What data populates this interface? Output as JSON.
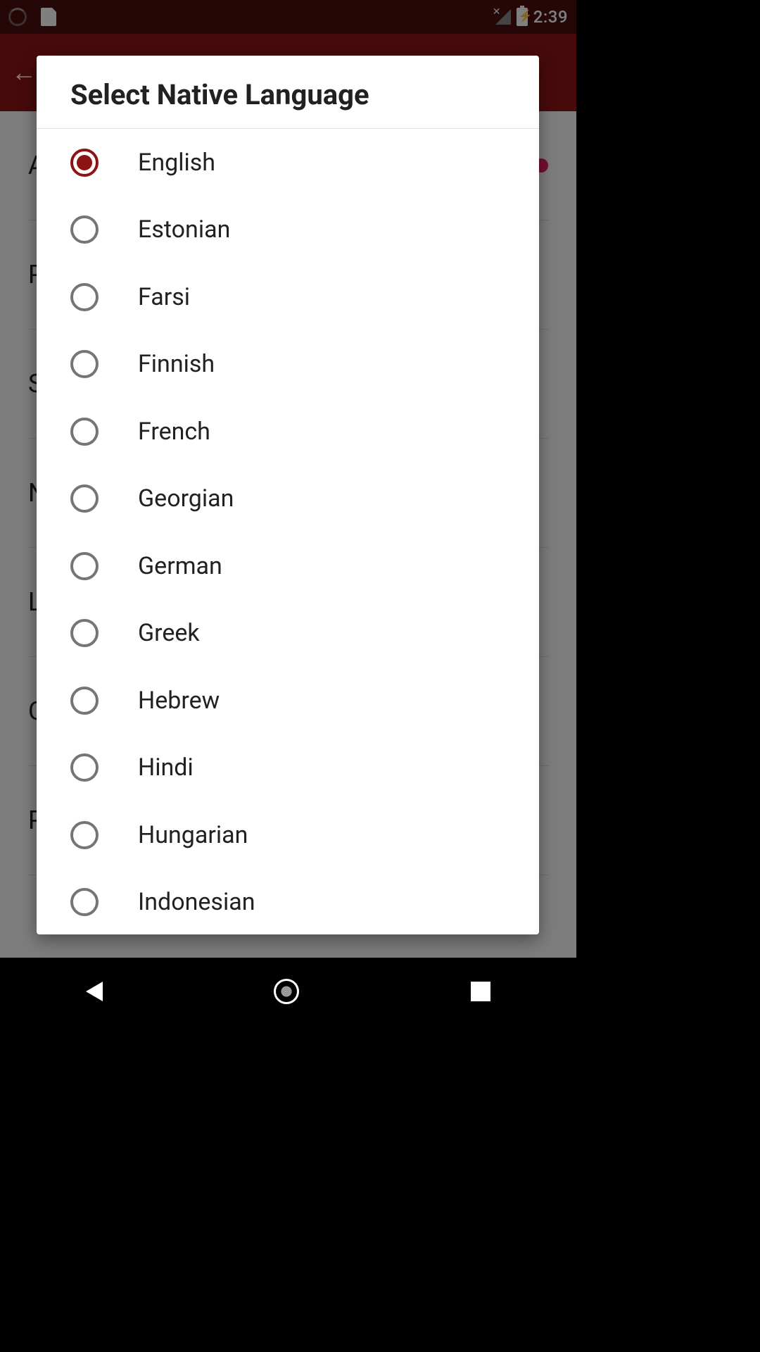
{
  "status_bar": {
    "time": "2:39"
  },
  "dialog": {
    "title": "Select Native Language",
    "selected_index": 0,
    "options": [
      "English",
      "Estonian",
      "Farsi",
      "Finnish",
      "French",
      "Georgian",
      "German",
      "Greek",
      "Hebrew",
      "Hindi",
      "Hungarian",
      "Indonesian"
    ]
  },
  "background": {
    "items": [
      "A",
      "P",
      "S",
      "N",
      "L",
      "C",
      "P"
    ]
  }
}
